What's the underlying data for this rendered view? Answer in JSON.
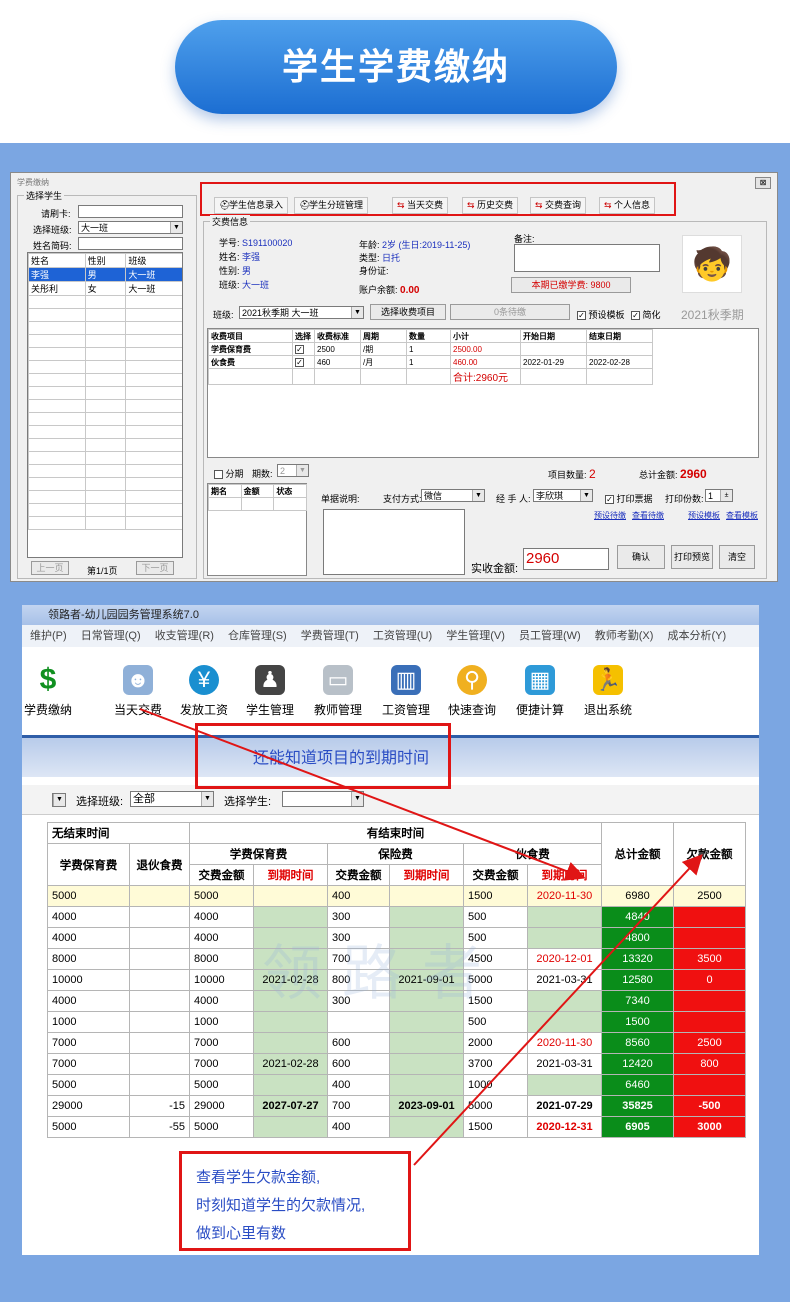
{
  "banner": {
    "title": "学生学费缴纳"
  },
  "win1": {
    "title": "学费缴纳",
    "close": "⊠",
    "select_group": "选择学生",
    "card_label": "请刷卡:",
    "class_label": "选择班级:",
    "class_value": "大一班",
    "name_label": "姓名简码:",
    "list_headers": [
      "姓名",
      "性别",
      "班级"
    ],
    "students": [
      {
        "name": "李强",
        "gender": "男",
        "class": "大一班"
      },
      {
        "name": "关彤利",
        "gender": "女",
        "class": "大一班"
      }
    ],
    "prev": "上一页",
    "page": "第1/1页",
    "next": "下一页",
    "toolbar": [
      "学生信息录入",
      "学生分班管理",
      "当天交费",
      "历史交费",
      "交费查询",
      "个人信息"
    ],
    "info_group": "交费信息",
    "sid_label": "学号:",
    "sid": "S191100020",
    "name2_label": "姓名:",
    "name2": "李强",
    "gender_label": "性别:",
    "gender": "男",
    "cls_label": "班级:",
    "cls": "大一班",
    "age_label": "年龄:",
    "age": "2岁 (生日:2019-11-25)",
    "type_label": "类型:",
    "type": "日托",
    "idcard_label": "身份证:",
    "balance_label": "账户余额:",
    "balance": "0.00",
    "remark_label": "备注:",
    "paid_label": "本期已缴学费: 9800",
    "term_label": "班级:",
    "term_value": "2021秋季期 大一班",
    "select_items_btn": "选择收费项目",
    "pending_btn": "0条待缴",
    "preset_label": "预设模板",
    "simplify_label": "简化",
    "term_title": "2021秋季期",
    "fee_headers": [
      "收费项目",
      "选择",
      "收费标准",
      "周期",
      "数量",
      "小计",
      "开始日期",
      "结束日期"
    ],
    "fees": [
      {
        "item": "学费保育费",
        "std": "2500",
        "cycle": "/期",
        "qty": "1",
        "sub": "2500.00",
        "start": "",
        "end": ""
      },
      {
        "item": "伙食费",
        "std": "460",
        "cycle": "/月",
        "qty": "1",
        "sub": "460.00",
        "start": "2022-01-29",
        "end": "2022-02-28"
      }
    ],
    "total_sub": "合计:2960元",
    "installment_label": "分期",
    "periods_label": "期数:",
    "periods_value": "2",
    "item_count_label": "项目数量:",
    "item_count": "2",
    "total_amount_label": "总计金额:",
    "total_amount": "2960",
    "inst_headers": [
      "期名",
      "金额",
      "状态"
    ],
    "remark2_label": "单据说明:",
    "pay_label": "支付方式:",
    "pay_value": "微信",
    "handler_label": "经 手 人:",
    "handler_value": "李欣琪",
    "print_label": "打印票据",
    "copies_label": "打印份数:",
    "copies_value": "1",
    "links": [
      "预设待缴",
      "查看待缴",
      "预设模板",
      "查看模板"
    ],
    "actual_label": "实收金额:",
    "actual_value": "2960",
    "confirm": "确认",
    "preview": "打印预览",
    "clear": "清空"
  },
  "win2": {
    "title": "领路者-幼儿园园务管理系统7.0",
    "menu": [
      "维护(P)",
      "日常管理(Q)",
      "收支管理(R)",
      "仓库管理(S)",
      "学费管理(T)",
      "工资管理(U)",
      "学生管理(V)",
      "员工管理(W)",
      "教师考勤(X)",
      "成本分析(Y)"
    ],
    "tools": [
      "学费缴纳",
      "当天交费",
      "发放工资",
      "学生管理",
      "教师管理",
      "工资管理",
      "快速查询",
      "便捷计算",
      "退出系统"
    ],
    "class_label": "选择班级:",
    "class_value": "全部",
    "student_label": "选择学生:",
    "group_no_end": "无结束时间",
    "group_with_end": "有结束时间",
    "col_tuition": "学费保育费",
    "col_refund": "退伙食费",
    "g_tuition": "学费保育费",
    "g_insurance": "保险费",
    "g_meal": "伙食费",
    "sub_amount": "交费金额",
    "sub_due": "到期时间",
    "col_total": "总计金额",
    "col_owe": "欠款金额",
    "rows": [
      [
        "5000",
        "",
        "5000",
        "",
        "400",
        "",
        "1500",
        "2020-11-30",
        "6980",
        "2500"
      ],
      [
        "4000",
        "",
        "4000",
        "",
        "300",
        "",
        "500",
        "",
        "4840",
        ""
      ],
      [
        "4000",
        "",
        "4000",
        "",
        "300",
        "",
        "500",
        "",
        "4800",
        ""
      ],
      [
        "8000",
        "",
        "8000",
        "",
        "700",
        "",
        "4500",
        "2020-12-01",
        "13320",
        "3500"
      ],
      [
        "10000",
        "",
        "10000",
        "2021-02-28",
        "800",
        "2021-09-01",
        "5000",
        "2021-03-31",
        "12580",
        "0"
      ],
      [
        "4000",
        "",
        "4000",
        "",
        "300",
        "",
        "1500",
        "",
        "7340",
        ""
      ],
      [
        "1000",
        "",
        "1000",
        "",
        "",
        "",
        "500",
        "",
        "1500",
        ""
      ],
      [
        "7000",
        "",
        "7000",
        "",
        "600",
        "",
        "2000",
        "2020-11-30",
        "8560",
        "2500"
      ],
      [
        "7000",
        "",
        "7000",
        "2021-02-28",
        "600",
        "",
        "3700",
        "2021-03-31",
        "12420",
        "800"
      ],
      [
        "5000",
        "",
        "5000",
        "",
        "400",
        "",
        "1000",
        "",
        "6460",
        ""
      ],
      [
        "29000",
        "-15",
        "29000",
        "2027-07-27",
        "700",
        "2023-09-01",
        "5000",
        "2021-07-29",
        "35825",
        "-500"
      ],
      [
        "5000",
        "-55",
        "5000",
        "",
        "400",
        "",
        "1500",
        "2020-12-31",
        "6905",
        "3000"
      ]
    ],
    "callout1": "还能知道项目的到期时间",
    "callout2": [
      "查看学生欠款金额,",
      "时刻知道学生的欠款情况,",
      "做到心里有数"
    ]
  }
}
